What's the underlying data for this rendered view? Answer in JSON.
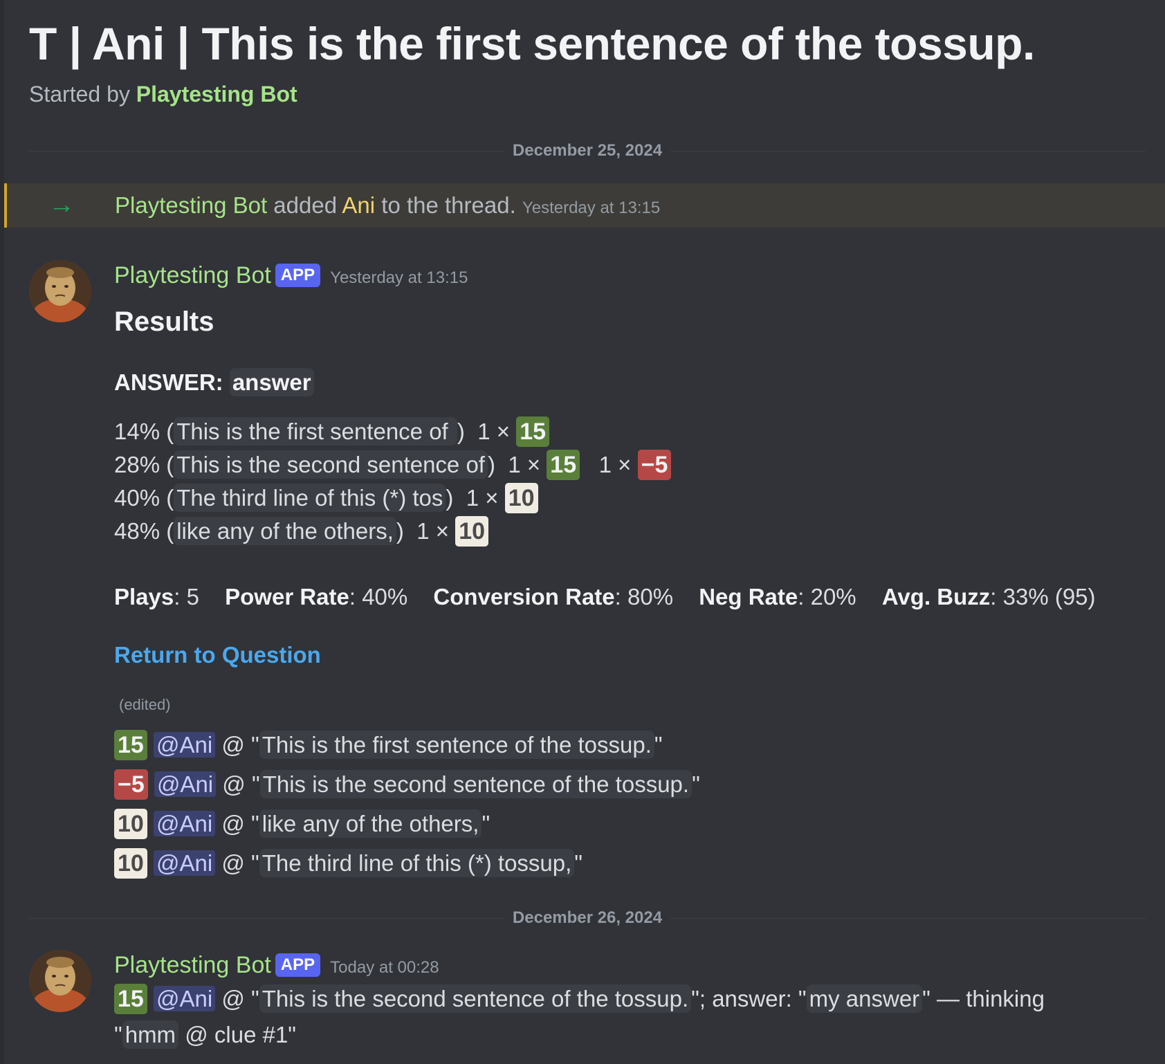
{
  "thread": {
    "title": "T | Ani | This is the first sentence of the tossup.",
    "started_by_prefix": "Started by ",
    "started_by_name": "Playtesting Bot"
  },
  "dividers": [
    "December 25, 2024",
    "December 26, 2024"
  ],
  "system_message": {
    "arrow": "→",
    "actor": "Playtesting Bot",
    "verb": " added ",
    "target": "Ani",
    "rest": " to the thread. ",
    "timestamp": "Yesterday at 13:15"
  },
  "message1": {
    "author": "Playtesting Bot",
    "badge": "APP",
    "timestamp": "Yesterday at 13:15",
    "title": "Results",
    "answer_label": "ANSWER: ",
    "answer_value": "answer",
    "buzz_rows": [
      {
        "pct": "14% (",
        "clue": "This is the first sentence of ",
        "close": ")",
        "c1_count": "1 × ",
        "c1_value": "15",
        "c2_count": "",
        "c2_value": ""
      },
      {
        "pct": "28% (",
        "clue": "This is the second sentence of",
        "close": ")",
        "c1_count": "1 × ",
        "c1_value": "15",
        "c2_count": "1 × ",
        "c2_value": "−5"
      },
      {
        "pct": "40% (",
        "clue": "The third line of this (*) tos",
        "close": ")",
        "c1_count": "1 × ",
        "c1_value": "10",
        "c2_count": "",
        "c2_value": ""
      },
      {
        "pct": "48% (",
        "clue": "like any of the others,",
        "close": ")",
        "c1_count": "1 × ",
        "c1_value": "10",
        "c2_count": "",
        "c2_value": ""
      }
    ],
    "stats": [
      {
        "label": "Plays",
        "value": ": 5"
      },
      {
        "label": "Power Rate",
        "value": ": 40%"
      },
      {
        "label": "Conversion Rate",
        "value": ": 80%"
      },
      {
        "label": "Neg Rate",
        "value": ": 20%"
      },
      {
        "label": "Avg. Buzz",
        "value": ": 33% (95)"
      }
    ],
    "link": "Return to Question",
    "edited": "(edited)",
    "buzz_log": [
      {
        "score": "15",
        "mention": "@Ani",
        "at": " @ \"",
        "text": "This is the first sentence of the tossup.",
        "end": "\""
      },
      {
        "score": "−5",
        "mention": "@Ani",
        "at": " @ \"",
        "text": "This is the second sentence of the tossup.",
        "end": "\""
      },
      {
        "score": "10",
        "mention": "@Ani",
        "at": " @ \"",
        "text": "like any of the others,",
        "end": "\""
      },
      {
        "score": "10",
        "mention": "@Ani",
        "at": " @ \"",
        "text": "The third line of this (*) tossup,",
        "end": "\""
      }
    ]
  },
  "message2": {
    "author": "Playtesting Bot",
    "badge": "APP",
    "timestamp": "Today at 00:28",
    "score": "15",
    "mention": "@Ani",
    "at": " @ \"",
    "clue": "This is the second sentence of the tossup.",
    "mid": "\"; answer: \"",
    "answer": "my answer",
    "after_answer": "\" — thinking",
    "open2": "\"",
    "thought": "hmm",
    "tail": " @ clue #1\""
  },
  "colors": {
    "background": "#313338",
    "author_green": "#a6e389",
    "power_chip": "#5a7f3a",
    "neg_chip": "#b54846",
    "ten_chip": "#f0ece2",
    "app_badge": "#5865f2",
    "link": "#4aa8ee",
    "system_bar": "#d4a52b"
  }
}
